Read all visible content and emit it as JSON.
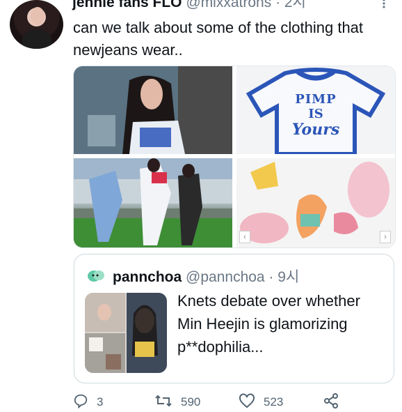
{
  "tweet": {
    "author_name": "jennie fans FLO",
    "author_handle": "@mixxatrons",
    "separator": "·",
    "time": "2시",
    "text": "can we talk about some of the clothing that newjeans wear..",
    "media": {
      "shirt_text_line1": "PIMP",
      "shirt_text_line2": "IS",
      "shirt_text_line3": "Yours"
    }
  },
  "quote": {
    "author_name": "pannchoa",
    "author_handle": "@pannchoa",
    "separator": "·",
    "time": "9시",
    "text": "Knets debate over whether Min Heejin is glamorizing p**dophilia..."
  },
  "actions": {
    "replies": "3",
    "retweets": "590",
    "likes": "523"
  },
  "icons": {
    "more": "more-icon",
    "reply": "reply-icon",
    "retweet": "retweet-icon",
    "like": "heart-icon",
    "share": "share-icon"
  },
  "colors": {
    "text": "#0f1419",
    "secondary": "#6b7785",
    "border": "#cfd9de",
    "shirt_blue": "#2b55b8"
  }
}
